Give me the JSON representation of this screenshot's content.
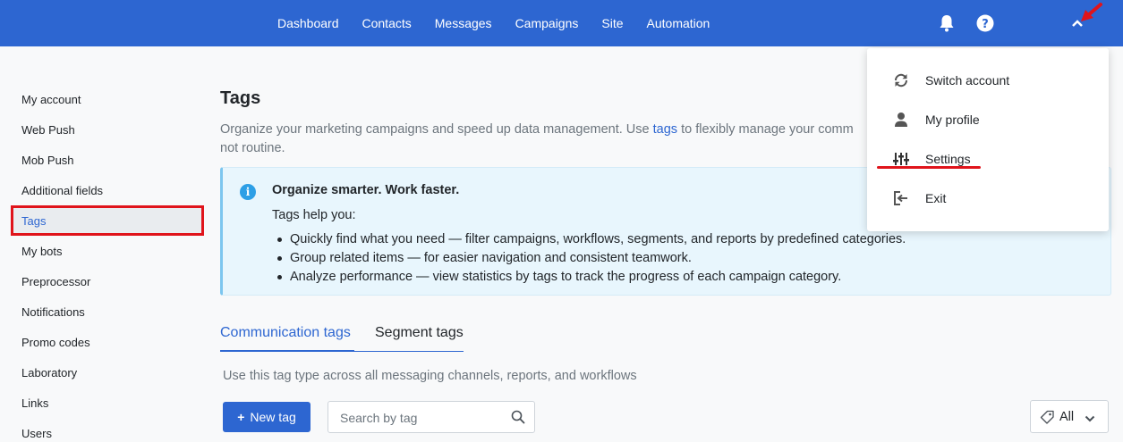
{
  "nav": {
    "items": [
      "Dashboard",
      "Contacts",
      "Messages",
      "Campaigns",
      "Site",
      "Automation"
    ],
    "icons": [
      "bell-icon",
      "help-icon",
      "chevron-up-icon"
    ],
    "accent_color": "#2d66d1"
  },
  "sidebar": {
    "items": [
      {
        "label": "My account"
      },
      {
        "label": "Web Push"
      },
      {
        "label": "Mob Push"
      },
      {
        "label": "Additional fields"
      },
      {
        "label": "Tags"
      },
      {
        "label": "My bots"
      },
      {
        "label": "Preprocessor"
      },
      {
        "label": "Notifications"
      },
      {
        "label": "Promo codes"
      },
      {
        "label": "Laboratory"
      },
      {
        "label": "Links"
      },
      {
        "label": "Users"
      }
    ],
    "active": "Tags"
  },
  "page": {
    "title": "Tags",
    "description_before": "Organize your marketing campaigns and speed up data management. Use ",
    "description_link": "tags",
    "description_after": " to flexibly manage your comm",
    "description_line2": "not routine."
  },
  "info": {
    "title": "Organize smarter. Work faster.",
    "subtitle": "Tags help you:",
    "bullets": [
      "Quickly find what you need — filter campaigns, workflows, segments, and reports by predefined categories.",
      "Group related items — for easier navigation and consistent teamwork.",
      "Analyze performance — view statistics by tags to track the progress of each campaign category."
    ]
  },
  "tabs": {
    "items": [
      "Communication tags",
      "Segment tags"
    ],
    "active": "Communication tags",
    "description": "Use this tag type across all messaging channels, reports, and workflows"
  },
  "toolbar": {
    "new_tag_label": "New tag",
    "search_placeholder": "Search by tag",
    "filter_label": "All"
  },
  "dropdown": {
    "items": [
      {
        "label": "Switch account",
        "icon": "refresh-icon"
      },
      {
        "label": "My profile",
        "icon": "user-icon"
      },
      {
        "label": "Settings",
        "icon": "sliders-icon"
      },
      {
        "label": "Exit",
        "icon": "exit-icon"
      }
    ],
    "highlight_color": "#e0141b"
  }
}
